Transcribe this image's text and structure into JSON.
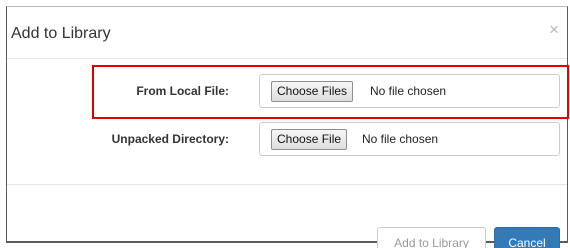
{
  "dialog": {
    "title": "Add to Library",
    "close_glyph": "×"
  },
  "form": {
    "local_file": {
      "label": "From Local File:",
      "button": "Choose Files",
      "status": "No file chosen"
    },
    "unpacked_directory": {
      "label": "Unpacked Directory:",
      "button": "Choose File",
      "status": "No file chosen"
    }
  },
  "footer": {
    "add_label": "Add to Library",
    "cancel_label": "Cancel"
  },
  "colors": {
    "primary": "#337ab7",
    "highlight": "#e00000",
    "disabled_text": "#9a9a9a"
  },
  "icons": {
    "close": "close-icon"
  }
}
